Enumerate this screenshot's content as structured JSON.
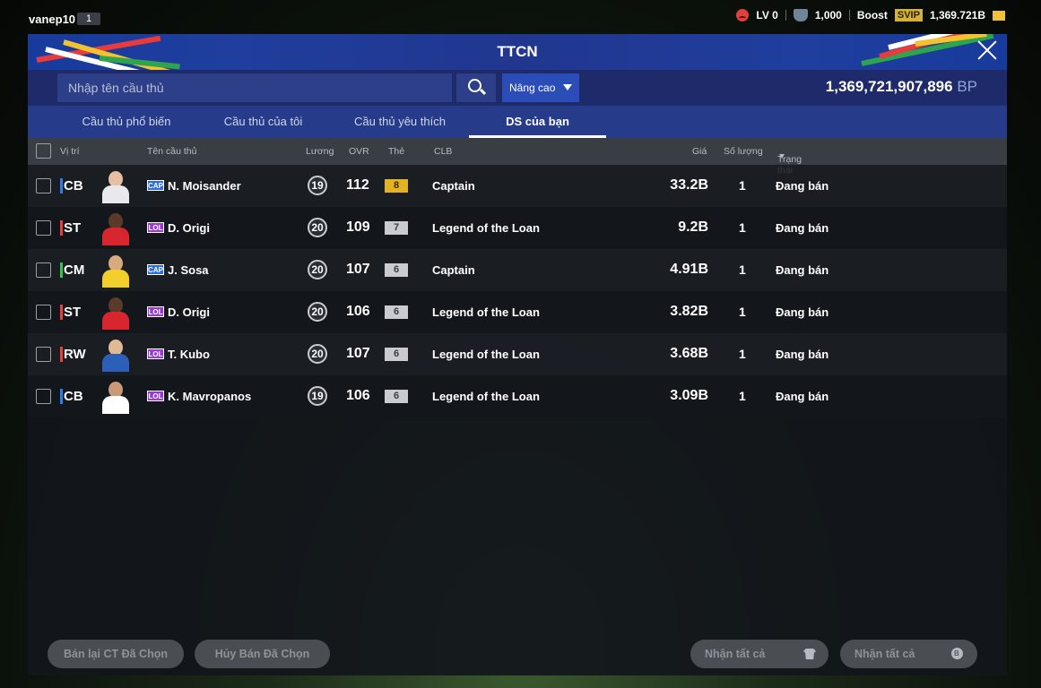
{
  "user": {
    "name": "vanep10",
    "level_badge": "1"
  },
  "status_bar": {
    "level": "LV 0",
    "coins": "1,000",
    "boost_label": "Boost",
    "svip_label": "SVIP",
    "bp_short": "1,369.721B"
  },
  "panel": {
    "title": "TTCN",
    "search": {
      "placeholder": "Nhập tên cầu thủ"
    },
    "advanced_label": "Nâng cao",
    "bp_total": "1,369,721,907,896",
    "bp_unit": "BP"
  },
  "tabs": [
    "Cầu thủ phổ biến",
    "Cầu thủ của tôi",
    "Cầu thủ yêu thích",
    "DS của bạn"
  ],
  "columns": {
    "position": "Vị trí",
    "name": "Tên cầu thủ",
    "salary": "Lương",
    "ovr": "OVR",
    "grade": "Thẻ",
    "club": "CLB",
    "price": "Giá",
    "quantity": "Số lượng",
    "status": "Trạng thái"
  },
  "rows": [
    {
      "pos": "CB",
      "pos_color": "#2f7ee6",
      "season": "CAP",
      "season_color": "#2f6dd8",
      "name": "N. Moisander",
      "salary": "19",
      "ovr": "112",
      "grade": "8",
      "grade_color": "#e3b322",
      "club": "Captain",
      "price": "33.2B",
      "qty": "1",
      "status": "Đang bán"
    },
    {
      "pos": "ST",
      "pos_color": "#e3433b",
      "season": "LOL",
      "season_color": "#9a3bd0",
      "name": "D. Origi",
      "salary": "20",
      "ovr": "109",
      "grade": "7",
      "grade_color": "#c9cbd0",
      "club": "Legend of the Loan",
      "price": "9.2B",
      "qty": "1",
      "status": "Đang bán"
    },
    {
      "pos": "CM",
      "pos_color": "#3fbf59",
      "season": "CAP",
      "season_color": "#2f6dd8",
      "name": "J. Sosa",
      "salary": "20",
      "ovr": "107",
      "grade": "6",
      "grade_color": "#c9cbd0",
      "club": "Captain",
      "price": "4.91B",
      "qty": "1",
      "status": "Đang bán"
    },
    {
      "pos": "ST",
      "pos_color": "#e3433b",
      "season": "LOL",
      "season_color": "#9a3bd0",
      "name": "D. Origi",
      "salary": "20",
      "ovr": "106",
      "grade": "6",
      "grade_color": "#c9cbd0",
      "club": "Legend of the Loan",
      "price": "3.82B",
      "qty": "1",
      "status": "Đang bán"
    },
    {
      "pos": "RW",
      "pos_color": "#e3433b",
      "season": "LOL",
      "season_color": "#9a3bd0",
      "name": "T. Kubo",
      "salary": "20",
      "ovr": "107",
      "grade": "6",
      "grade_color": "#c9cbd0",
      "club": "Legend of the Loan",
      "price": "3.68B",
      "qty": "1",
      "status": "Đang bán"
    },
    {
      "pos": "CB",
      "pos_color": "#2f7ee6",
      "season": "LOL",
      "season_color": "#9a3bd0",
      "name": "K. Mavropanos",
      "salary": "19",
      "ovr": "106",
      "grade": "6",
      "grade_color": "#c9cbd0",
      "club": "Legend of the Loan",
      "price": "3.09B",
      "qty": "1",
      "status": "Đang bán"
    }
  ],
  "footer": {
    "resell_selected": "Bán lại CT Đã Chọn",
    "cancel_selected": "Hủy Bán Đã Chọn",
    "claim_all_players": "Nhận tất cả",
    "claim_all_bp": "Nhận tất cả"
  }
}
